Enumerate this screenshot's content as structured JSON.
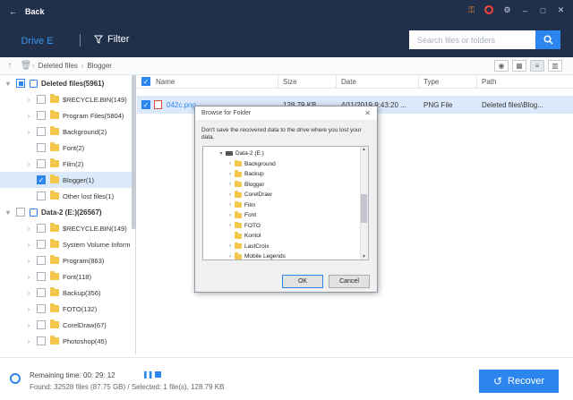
{
  "header": {
    "back_label": "Back",
    "drive_tab": "Drive E",
    "filter_label": "Filter",
    "search_placeholder": "Search files or folders",
    "window_icons": [
      "key-icon",
      "share-icon",
      "settings-icon",
      "minimize-icon",
      "maximize-icon",
      "close-icon"
    ]
  },
  "breadcrumb": {
    "items": [
      "Deleted files",
      "Blogger"
    ]
  },
  "tree": {
    "nodes": [
      {
        "label": "Deleted files(5961)",
        "level": 0,
        "type": "root",
        "check": "partial",
        "expand": "open"
      },
      {
        "label": "$RECYCLE.BIN(149)",
        "level": 1,
        "type": "folder",
        "check": "off",
        "expand": "closed"
      },
      {
        "label": "Program Files(5804)",
        "level": 1,
        "type": "folder",
        "check": "off",
        "expand": "closed"
      },
      {
        "label": "Background(2)",
        "level": 1,
        "type": "folder",
        "check": "off",
        "expand": "closed"
      },
      {
        "label": "Font(2)",
        "level": 1,
        "type": "folder",
        "check": "off",
        "expand": "none"
      },
      {
        "label": "Film(2)",
        "level": 1,
        "type": "folder",
        "check": "off",
        "expand": "closed"
      },
      {
        "label": "Blogger(1)",
        "level": 1,
        "type": "folder",
        "check": "on",
        "expand": "none",
        "selected": true
      },
      {
        "label": "Other lost files(1)",
        "level": 1,
        "type": "folder",
        "check": "off",
        "expand": "none"
      },
      {
        "label": "Data-2 (E:)(26567)",
        "level": 0,
        "type": "drive",
        "check": "off",
        "expand": "open"
      },
      {
        "label": "$RECYCLE.BIN(149)",
        "level": 1,
        "type": "folder",
        "check": "off",
        "expand": "closed"
      },
      {
        "label": "System Volume Inform",
        "level": 1,
        "type": "folder",
        "check": "off",
        "expand": "closed"
      },
      {
        "label": "Program(863)",
        "level": 1,
        "type": "folder",
        "check": "off",
        "expand": "closed"
      },
      {
        "label": "Font(118)",
        "level": 1,
        "type": "folder",
        "check": "off",
        "expand": "closed"
      },
      {
        "label": "Backup(356)",
        "level": 1,
        "type": "folder",
        "check": "off",
        "expand": "closed"
      },
      {
        "label": "FOTO(132)",
        "level": 1,
        "type": "folder",
        "check": "off",
        "expand": "closed"
      },
      {
        "label": "CorelDraw(67)",
        "level": 1,
        "type": "folder",
        "check": "off",
        "expand": "closed"
      },
      {
        "label": "Photoshop(45)",
        "level": 1,
        "type": "folder",
        "check": "off",
        "expand": "closed"
      }
    ]
  },
  "grid": {
    "columns": [
      "Name",
      "Size",
      "Date",
      "Type",
      "Path"
    ],
    "rows": [
      {
        "name": "042c.png",
        "size": "128.79 KB",
        "date": "4/11/2019 9:43:20 ...",
        "type": "PNG File",
        "path": "Deleted files\\Blog..."
      }
    ]
  },
  "dialog": {
    "title": "Browse for Folder",
    "message": "Don't save the recovered data to the drive where you lost your data.",
    "items": [
      {
        "label": "Data-2 (E:)",
        "drive": true,
        "expand": "open"
      },
      {
        "label": "Background",
        "expand": "closed"
      },
      {
        "label": "Backup",
        "expand": "closed"
      },
      {
        "label": "Blogger",
        "expand": "closed"
      },
      {
        "label": "CorelDraw",
        "expand": "closed"
      },
      {
        "label": "Film",
        "expand": "closed"
      },
      {
        "label": "Font",
        "expand": "closed"
      },
      {
        "label": "FOTO",
        "expand": "closed"
      },
      {
        "label": "Kontol",
        "expand": "none"
      },
      {
        "label": "LastCroix",
        "expand": "closed"
      },
      {
        "label": "Mobile Legends",
        "expand": "closed"
      }
    ],
    "ok_label": "OK",
    "cancel_label": "Cancel"
  },
  "status": {
    "remaining": "Remaining time: 00: 29: 12",
    "found": "Found: 32528 files (87.75 GB) / Selected: 1 file(s), 128.79 KB"
  },
  "recover_label": "Recover",
  "colors": {
    "header_bg": "#21304a",
    "accent": "#2d86f0",
    "folder": "#f3c64c",
    "selection": "#dbe9fb"
  }
}
